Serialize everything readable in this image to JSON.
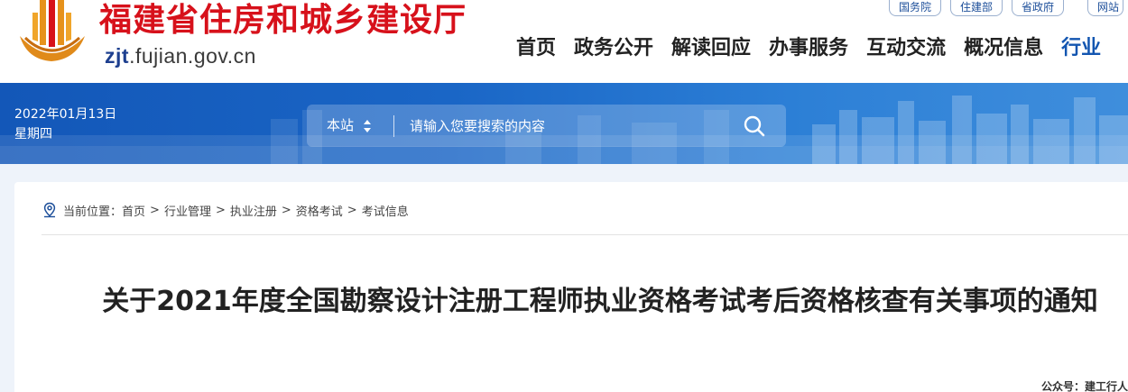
{
  "header": {
    "site_title": "福建省住房和城乡建设厅",
    "domain_prefix": "zjt",
    "domain_rest": ".fujian.gov.cn",
    "top_links": [
      "国务院",
      "住建部",
      "省政府",
      "网站"
    ],
    "nav": [
      "首页",
      "政务公开",
      "解读回应",
      "办事服务",
      "互动交流",
      "概况信息",
      "行业"
    ]
  },
  "banner": {
    "date": "2022年01月13日",
    "weekday": "星期四",
    "search": {
      "scope_label": "本站",
      "placeholder": "请输入您要搜索的内容"
    }
  },
  "breadcrumb": {
    "prefix": "当前位置：",
    "items": [
      "首页",
      "行业管理",
      "执业注册",
      "资格考试",
      "考试信息"
    ],
    "separator": ">"
  },
  "article": {
    "title": "关于2021年度全国勘察设计注册工程师执业资格考试考后资格核查有关事项的通知"
  },
  "watermark": "公众号：建工行人",
  "colors": {
    "brand_red": "#d7111b",
    "brand_blue": "#1255b0",
    "banner_blue": "#1a66c6"
  }
}
